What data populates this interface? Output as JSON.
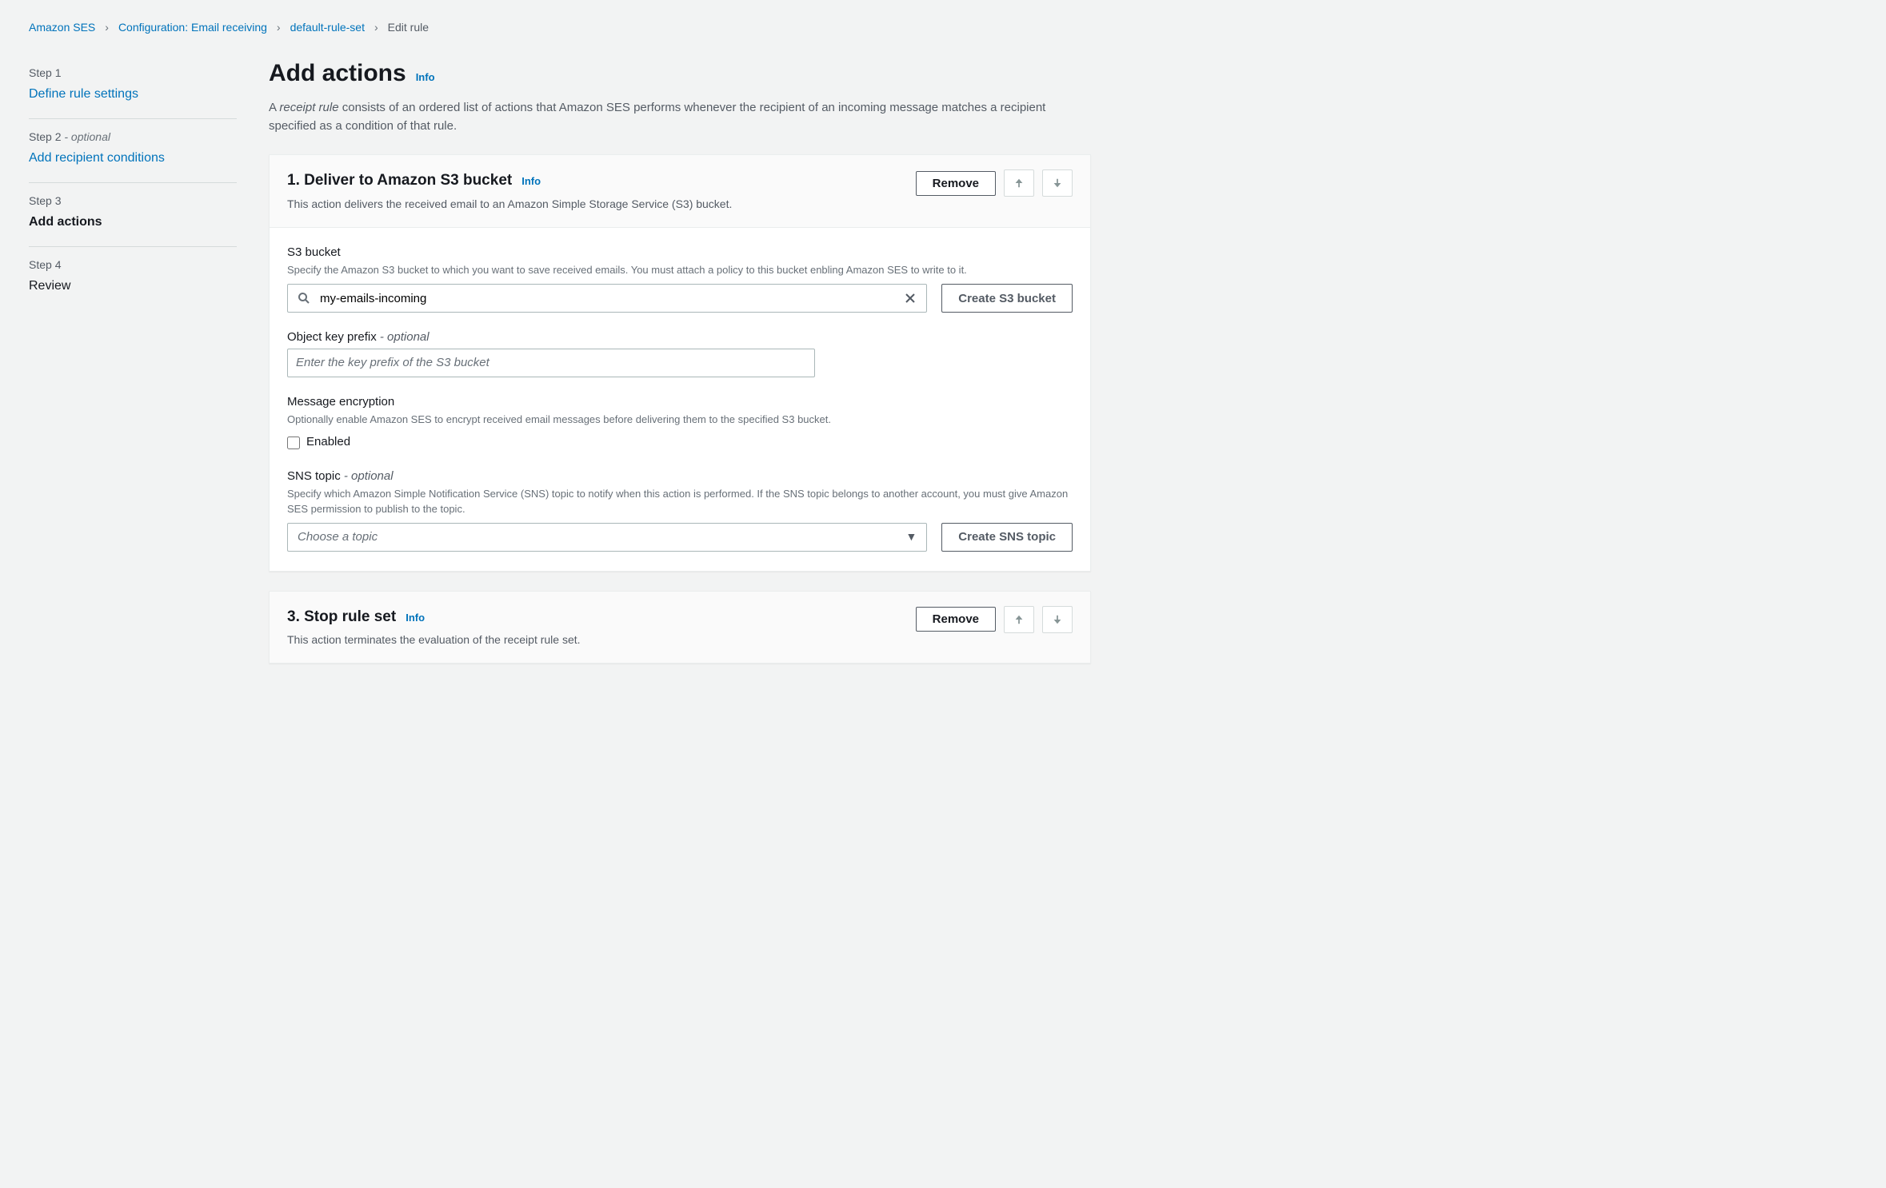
{
  "breadcrumb": {
    "items": [
      {
        "label": "Amazon SES",
        "link": true
      },
      {
        "label": "Configuration: Email receiving",
        "link": true
      },
      {
        "label": "default-rule-set",
        "link": true
      },
      {
        "label": "Edit rule",
        "link": false
      }
    ]
  },
  "sidebar": {
    "steps": [
      {
        "label": "Step 1",
        "optional": "",
        "title": "Define rule settings",
        "link": true,
        "current": false
      },
      {
        "label": "Step 2",
        "optional": " - optional",
        "title": "Add recipient conditions",
        "link": true,
        "current": false
      },
      {
        "label": "Step 3",
        "optional": "",
        "title": "Add actions",
        "link": false,
        "current": true
      },
      {
        "label": "Step 4",
        "optional": "",
        "title": "Review",
        "link": false,
        "current": false
      }
    ]
  },
  "page": {
    "title": "Add actions",
    "info": "Info",
    "desc_prefix": "A ",
    "desc_em": "receipt rule",
    "desc_rest": " consists of an ordered list of actions that Amazon SES performs whenever the recipient of an incoming message matches a recipient specified as a condition of that rule."
  },
  "action1": {
    "title": "1. Deliver to Amazon S3 bucket",
    "info": "Info",
    "subtitle": "This action delivers the received email to an Amazon Simple Storage Service (S3) bucket.",
    "remove": "Remove",
    "s3_label": "S3 bucket",
    "s3_hint": "Specify the Amazon S3 bucket to which you want to save received emails. You must attach a policy to this bucket enbling Amazon SES to write to it.",
    "s3_value": "my-emails-incoming",
    "s3_create": "Create S3 bucket",
    "prefix_label": "Object key prefix",
    "prefix_optional": " - optional",
    "prefix_placeholder": "Enter the key prefix of the S3 bucket",
    "encrypt_label": "Message encryption",
    "encrypt_hint": "Optionally enable Amazon SES to encrypt received email messages before delivering them to the specified S3 bucket.",
    "encrypt_checkbox": "Enabled",
    "sns_label": "SNS topic",
    "sns_optional": " - optional",
    "sns_hint": "Specify which Amazon Simple Notification Service (SNS) topic to notify when this action is performed. If the SNS topic belongs to another account, you must give Amazon SES permission to publish to the topic.",
    "sns_placeholder": "Choose a topic",
    "sns_create": "Create SNS topic"
  },
  "action3": {
    "title": "3. Stop rule set",
    "info": "Info",
    "subtitle": "This action terminates the evaluation of the receipt rule set.",
    "remove": "Remove"
  }
}
